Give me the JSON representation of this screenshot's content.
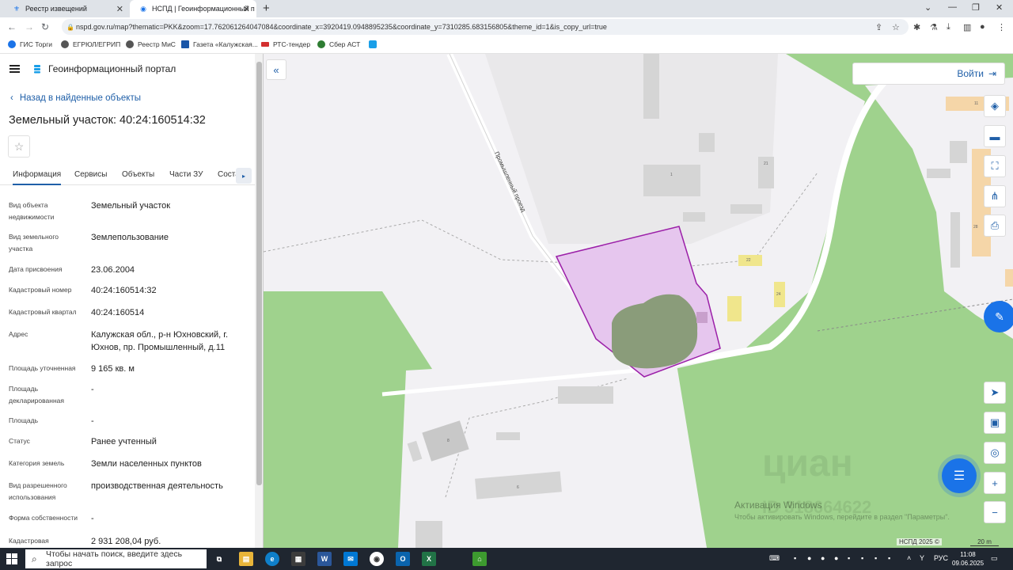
{
  "browser": {
    "tabs": [
      {
        "label": "Реестр извещений"
      },
      {
        "label": "НСПД | Геоинформационный п"
      }
    ],
    "url": "nspd.gov.ru/map?thematic=PKK&zoom=17.762061264047084&coordinate_x=3920419.0948895235&coordinate_y=7310285.683156805&theme_id=1&is_copy_url=true",
    "bookmarks": [
      {
        "label": "ГИС Торги",
        "color": "#1a73e8"
      },
      {
        "label": "ЕГРЮЛ/ЕГРИП",
        "color": "#555"
      },
      {
        "label": "Реестр МиС",
        "color": "#555"
      },
      {
        "label": "Газета «Калужская...",
        "color": "#1a56a8"
      },
      {
        "label": "РТС-тендер",
        "color": "#d32f2f"
      },
      {
        "label": "Сбер АСТ",
        "color": "#2e7d32"
      }
    ]
  },
  "sidebar": {
    "portal_title": "Геоинформационный портал",
    "back_link": "Назад в найденные объекты",
    "object_title": "Земельный участок: 40:24:160514:32",
    "tabs": [
      "Информация",
      "Сервисы",
      "Объекты",
      "Части ЗУ",
      "Соста"
    ],
    "properties": [
      {
        "label": "Вид объекта недвижимости",
        "value": "Земельный участок"
      },
      {
        "label": "Вид земельного участка",
        "value": "Землепользование"
      },
      {
        "label": "Дата присвоения",
        "value": "23.06.2004"
      },
      {
        "label": "Кадастровый номер",
        "value": "40:24:160514:32"
      },
      {
        "label": "Кадастровый квартал",
        "value": "40:24:160514"
      },
      {
        "label": "Адрес",
        "value": "Калужская обл., р-н Юхновский, г. Юхнов, пр. Промышленный, д.11"
      },
      {
        "label": "Площадь уточненная",
        "value": "9 165 кв. м"
      },
      {
        "label": "Площадь декларированная",
        "value": "-"
      },
      {
        "label": "Площадь",
        "value": "-"
      },
      {
        "label": "Статус",
        "value": "Ранее учтенный"
      },
      {
        "label": "Категория земель",
        "value": "Земли населенных пунктов"
      },
      {
        "label": "Вид разрешенного использования",
        "value": "производственная деятельность"
      },
      {
        "label": "Форма собственности",
        "value": "-"
      },
      {
        "label": "Кадастровая",
        "value": "2 931 208,04 руб."
      }
    ]
  },
  "map": {
    "login_label": "Войти",
    "street_label": "Промышленный проезд",
    "house_numbers": [
      "11",
      "21",
      "1",
      "22",
      "24",
      "18",
      "28",
      "6",
      "8"
    ],
    "watermark_text": "циан",
    "watermark_id": "ID 318664622",
    "activate_line1": "Активация Windows",
    "activate_line2": "Чтобы активировать Windows, перейдите в раздел \"Параметры\".",
    "copyright": "НСПД 2025 ©",
    "scale": "20 m",
    "colors": {
      "forest": "#9fd28d",
      "parcel_fill": "#e6c6ee",
      "parcel_stroke": "#9b1fa8",
      "pond": "#8a9c7a",
      "building": "#d5d5d5",
      "yellow": "#f0e68c",
      "orange": "#f5d6a8"
    }
  },
  "taskbar": {
    "search_placeholder": "Чтобы начать поиск, введите здесь запрос",
    "lang": "РУС",
    "time": "11:08",
    "date": "09.06.2025"
  }
}
